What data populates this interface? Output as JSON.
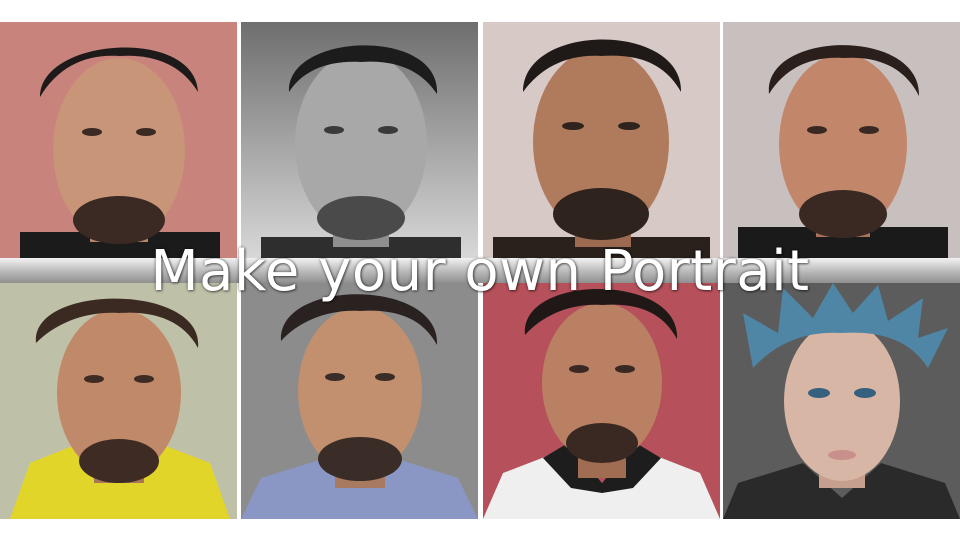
{
  "headline": "Make your own Portrait",
  "colors": {
    "background": "#ffffff",
    "headline_text": "#ffffff",
    "banner_gradient": [
      "#f2f2f2",
      "#b9b9b9",
      "#8f8f8f"
    ]
  },
  "portraits": [
    {
      "style": "photo",
      "backdrop": "#c9837d",
      "hair": "#1e1a19",
      "skin": "#c99578",
      "clothing": "#1b1b1b"
    },
    {
      "style": "black-and-white",
      "backdrop": "#7a7a7a",
      "hair": "#1c1c1c",
      "skin": "#a8a8a8",
      "clothing": "#2e2e2e"
    },
    {
      "style": "painted",
      "backdrop": "#d7c9c6",
      "hair": "#1f1a18",
      "skin": "#b07a5c",
      "clothing": "#2a211d"
    },
    {
      "style": "painted",
      "backdrop": "#c8c0bf",
      "hair": "#2a1f1b",
      "skin": "#c2876a",
      "clothing": "#1a1a1a"
    },
    {
      "style": "painted",
      "backdrop": "#bfc0a8",
      "hair": "#3a2a22",
      "skin": "#c0896a",
      "clothing": "#e2d52a"
    },
    {
      "style": "painted",
      "backdrop": "#8c8c8c",
      "hair": "#2a2220",
      "skin": "#c2906f",
      "clothing": "#8a97c4"
    },
    {
      "style": "photo",
      "backdrop": "#b6505a",
      "hair": "#1f1816",
      "skin": "#b98063",
      "clothing": "#efefef"
    },
    {
      "style": "fantasy",
      "backdrop": "#5c5c5c",
      "hair": "#4f86a6",
      "skin": "#d8b6a6",
      "clothing": "#2a2a2a"
    }
  ]
}
